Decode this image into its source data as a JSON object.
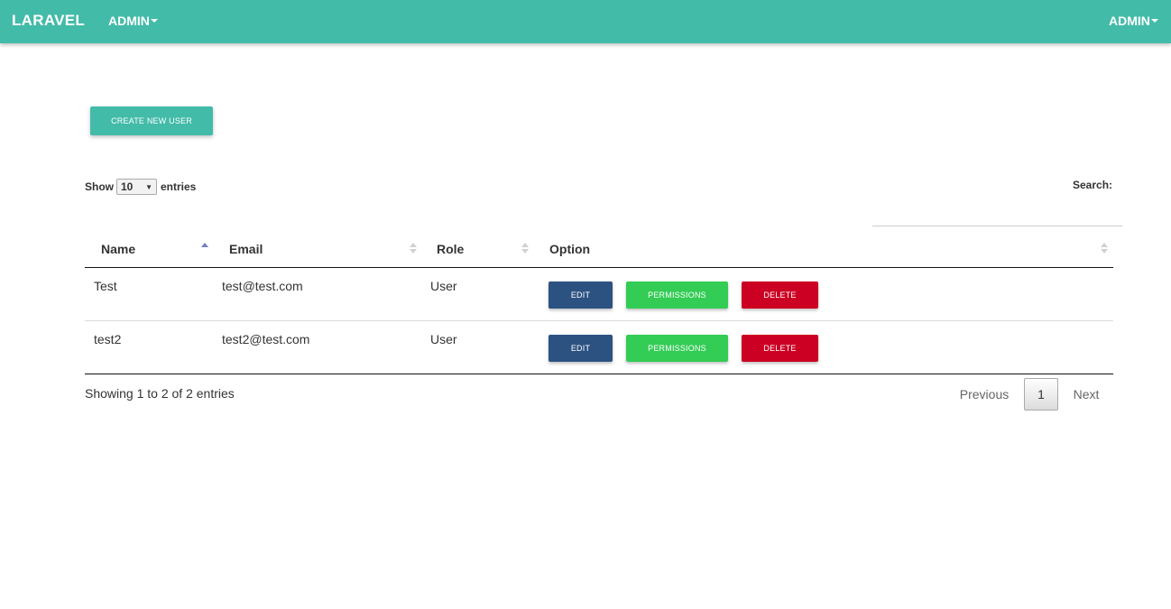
{
  "navbar": {
    "brand": "LARAVEL",
    "left_menu": "ADMIN",
    "right_menu": "ADMIN"
  },
  "toolbar": {
    "create_label": "CREATE NEW USER"
  },
  "length": {
    "show_label": "Show",
    "value": "10",
    "entries_label": "entries"
  },
  "search": {
    "label": "Search:",
    "value": ""
  },
  "table": {
    "columns": [
      "Name",
      "Email",
      "Role",
      "Option"
    ],
    "sort": {
      "column": "Name",
      "direction": "ascending"
    },
    "rows": [
      {
        "name": "Test",
        "email": "test@test.com",
        "role": "User"
      },
      {
        "name": "test2",
        "email": "test2@test.com",
        "role": "User"
      }
    ],
    "actions": {
      "edit": "EDIT",
      "permissions": "PERMISSIONS",
      "delete": "DELETE"
    }
  },
  "footer": {
    "info": "Showing 1 to 2 of 2 entries",
    "previous": "Previous",
    "page": "1",
    "next": "Next"
  },
  "colors": {
    "navbar": "#43bba9",
    "edit": "#2c5282",
    "permissions": "#33cc55",
    "delete": "#cc0022",
    "sort_active": "#6f7fc8"
  }
}
